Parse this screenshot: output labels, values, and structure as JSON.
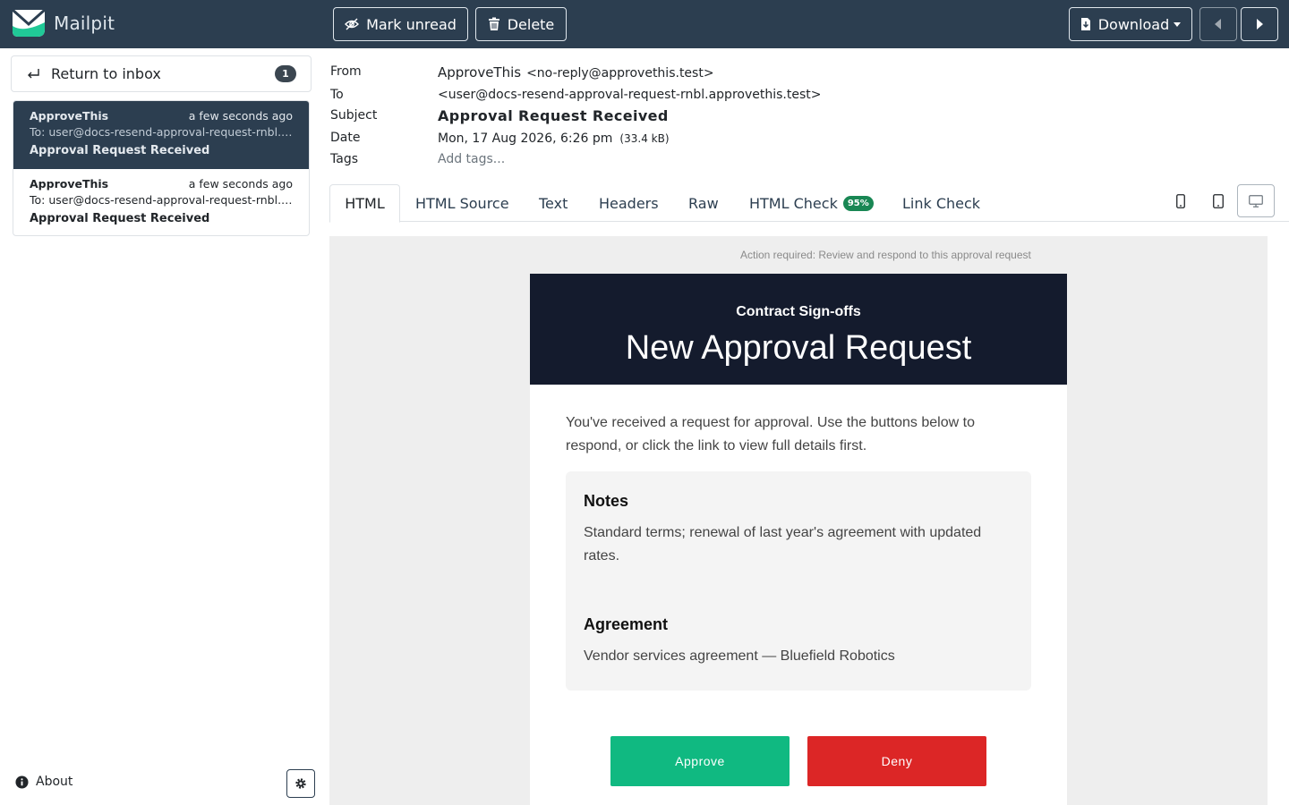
{
  "app": {
    "name": "Mailpit"
  },
  "toolbar": {
    "mark_unread": "Mark unread",
    "delete": "Delete",
    "download": "Download"
  },
  "sidebar": {
    "return_label": "Return to inbox",
    "unread_count": "1",
    "messages": [
      {
        "from": "ApproveThis",
        "time": "a few seconds ago",
        "to": "To: user@docs-resend-approval-request-rnbl.approvethis.test",
        "subject": "Approval Request Received",
        "active": true
      },
      {
        "from": "ApproveThis",
        "time": "a few seconds ago",
        "to": "To: user@docs-resend-approval-request-rnbl.approvethis.test",
        "subject": "Approval Request Received",
        "active": false
      }
    ],
    "about": "About"
  },
  "headers": {
    "from_label": "From",
    "from_name": "ApproveThis",
    "from_addr": "<no-reply@approvethis.test>",
    "to_label": "To",
    "to_addr": "<user@docs-resend-approval-request-rnbl.approvethis.test>",
    "subject_label": "Subject",
    "subject": "Approval Request Received",
    "date_label": "Date",
    "date": "Mon, 17 Aug 2026, 6:26 pm",
    "size": "(33.4 kB)",
    "tags_label": "Tags",
    "tags_placeholder": "Add tags..."
  },
  "tabs": {
    "html": "HTML",
    "html_source": "HTML Source",
    "text": "Text",
    "headers": "Headers",
    "raw": "Raw",
    "html_check": "HTML Check",
    "html_check_score": "95%",
    "link_check": "Link Check",
    "active": "HTML",
    "active_device": "desktop"
  },
  "email": {
    "preheader": "Action required: Review and respond to this approval request",
    "kicker": "Contract Sign-offs",
    "title": "New Approval Request",
    "intro": "You've received a request for approval. Use the buttons below to respond, or click the link to view full details first.",
    "notes_heading": "Notes",
    "notes_text": "Standard terms; renewal of last year's agreement with updated rates.",
    "agreement_heading": "Agreement",
    "agreement_text": "Vendor services agreement — Bluefield Robotics",
    "approve_label": "Approve",
    "deny_label": "Deny",
    "approve_color": "#10b981",
    "deny_color": "#dc2626",
    "header_color": "#141b2d"
  },
  "colors": {
    "topbar": "#2c3e50",
    "accent_badge": "#198754"
  }
}
